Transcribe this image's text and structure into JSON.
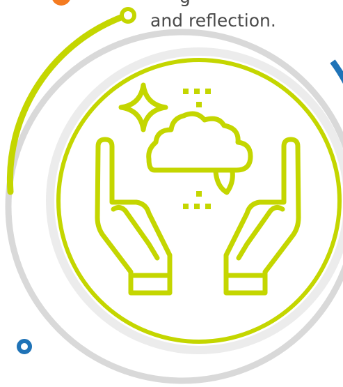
{
  "caption": {
    "line_partial": "g",
    "line_2": "and reflection."
  },
  "icon_name": "hands-cloud-sparkle-icon",
  "colors": {
    "accent_lime": "#c4d600",
    "ring_gray": "#d9d9d9",
    "inner_ring_gray": "#ececec",
    "dot_orange": "#f47b20",
    "dot_blue": "#1f73b7",
    "text": "#4a4a4a"
  }
}
